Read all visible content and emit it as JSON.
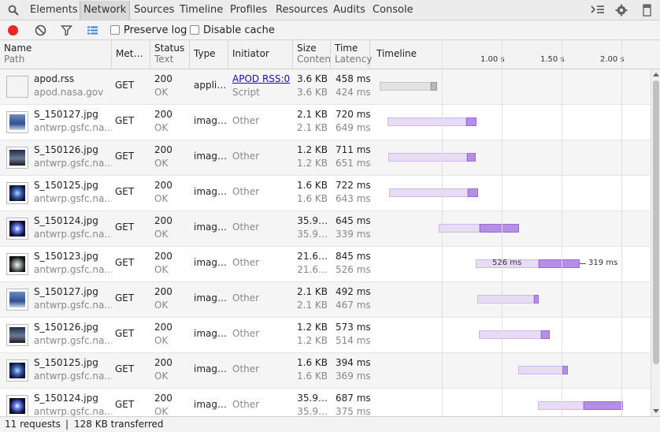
{
  "tabs": [
    "Elements",
    "Network",
    "Sources",
    "Timeline",
    "Profiles",
    "Resources",
    "Audits",
    "Console"
  ],
  "active_tab": "Network",
  "toolbar": {
    "preserve_log": "Preserve log",
    "disable_cache": "Disable cache"
  },
  "columns": {
    "name": "Name",
    "path": "Path",
    "method": "Met…",
    "status": "Status",
    "status_text": "Text",
    "type": "Type",
    "initiator": "Initiator",
    "size": "Size",
    "content": "Conten",
    "time": "Time",
    "latency": "Latency",
    "timeline": "Timeline",
    "ticks": [
      "1.00 s",
      "1.50 s",
      "2.00 s"
    ]
  },
  "rows": [
    {
      "name": "apod.rss",
      "path": "apod.nasa.gov",
      "method": "GET",
      "status": "200",
      "status_text": "OK",
      "type": "appli…",
      "initiator": "APOD RSS:0",
      "initiator2": "Script",
      "size": "3.6 KB",
      "content": "3.6 KB",
      "time": "458 ms",
      "latency": "424 ms"
    },
    {
      "name": "S_150127.jpg",
      "path": "antwrp.gsfc.na…",
      "method": "GET",
      "status": "200",
      "status_text": "OK",
      "type": "imag…",
      "initiator": "Other",
      "size": "2.1 KB",
      "content": "2.1 KB",
      "time": "720 ms",
      "latency": "649 ms"
    },
    {
      "name": "S_150126.jpg",
      "path": "antwrp.gsfc.na…",
      "method": "GET",
      "status": "200",
      "status_text": "OK",
      "type": "imag…",
      "initiator": "Other",
      "size": "1.2 KB",
      "content": "1.2 KB",
      "time": "711 ms",
      "latency": "651 ms"
    },
    {
      "name": "S_150125.jpg",
      "path": "antwrp.gsfc.na…",
      "method": "GET",
      "status": "200",
      "status_text": "OK",
      "type": "imag…",
      "initiator": "Other",
      "size": "1.6 KB",
      "content": "1.6 KB",
      "time": "722 ms",
      "latency": "643 ms"
    },
    {
      "name": "S_150124.jpg",
      "path": "antwrp.gsfc.na…",
      "method": "GET",
      "status": "200",
      "status_text": "OK",
      "type": "imag…",
      "initiator": "Other",
      "size": "35.9…",
      "content": "35.9…",
      "time": "645 ms",
      "latency": "339 ms"
    },
    {
      "name": "S_150123.jpg",
      "path": "antwrp.gsfc.na…",
      "method": "GET",
      "status": "200",
      "status_text": "OK",
      "type": "imag…",
      "initiator": "Other",
      "size": "21.6…",
      "content": "21.6…",
      "time": "845 ms",
      "latency": "526 ms",
      "bar_latency_label": "526 ms",
      "bar_download_label": "319 ms"
    },
    {
      "name": "S_150127.jpg",
      "path": "antwrp.gsfc.na…",
      "method": "GET",
      "status": "200",
      "status_text": "OK",
      "type": "imag…",
      "initiator": "Other",
      "size": "2.1 KB",
      "content": "2.1 KB",
      "time": "492 ms",
      "latency": "467 ms"
    },
    {
      "name": "S_150126.jpg",
      "path": "antwrp.gsfc.na…",
      "method": "GET",
      "status": "200",
      "status_text": "OK",
      "type": "imag…",
      "initiator": "Other",
      "size": "1.2 KB",
      "content": "1.2 KB",
      "time": "573 ms",
      "latency": "514 ms"
    },
    {
      "name": "S_150125.jpg",
      "path": "antwrp.gsfc.na…",
      "method": "GET",
      "status": "200",
      "status_text": "OK",
      "type": "imag…",
      "initiator": "Other",
      "size": "1.6 KB",
      "content": "1.6 KB",
      "time": "394 ms",
      "latency": "369 ms"
    },
    {
      "name": "S_150124.jpg",
      "path": "antwrp.gsfc.na…",
      "method": "GET",
      "status": "200",
      "status_text": "OK",
      "type": "imag…",
      "initiator": "Other",
      "size": "35.9…",
      "content": "35.9…",
      "time": "687 ms",
      "latency": "375 ms"
    }
  ],
  "status": {
    "requests": "11 requests",
    "separator": "|",
    "transferred": "128 KB transferred"
  },
  "colors": {
    "record": "#ee2424",
    "link": "#1a0dab",
    "bar_wait": "#e8dcf5",
    "bar_receive": "#b58fe6"
  }
}
